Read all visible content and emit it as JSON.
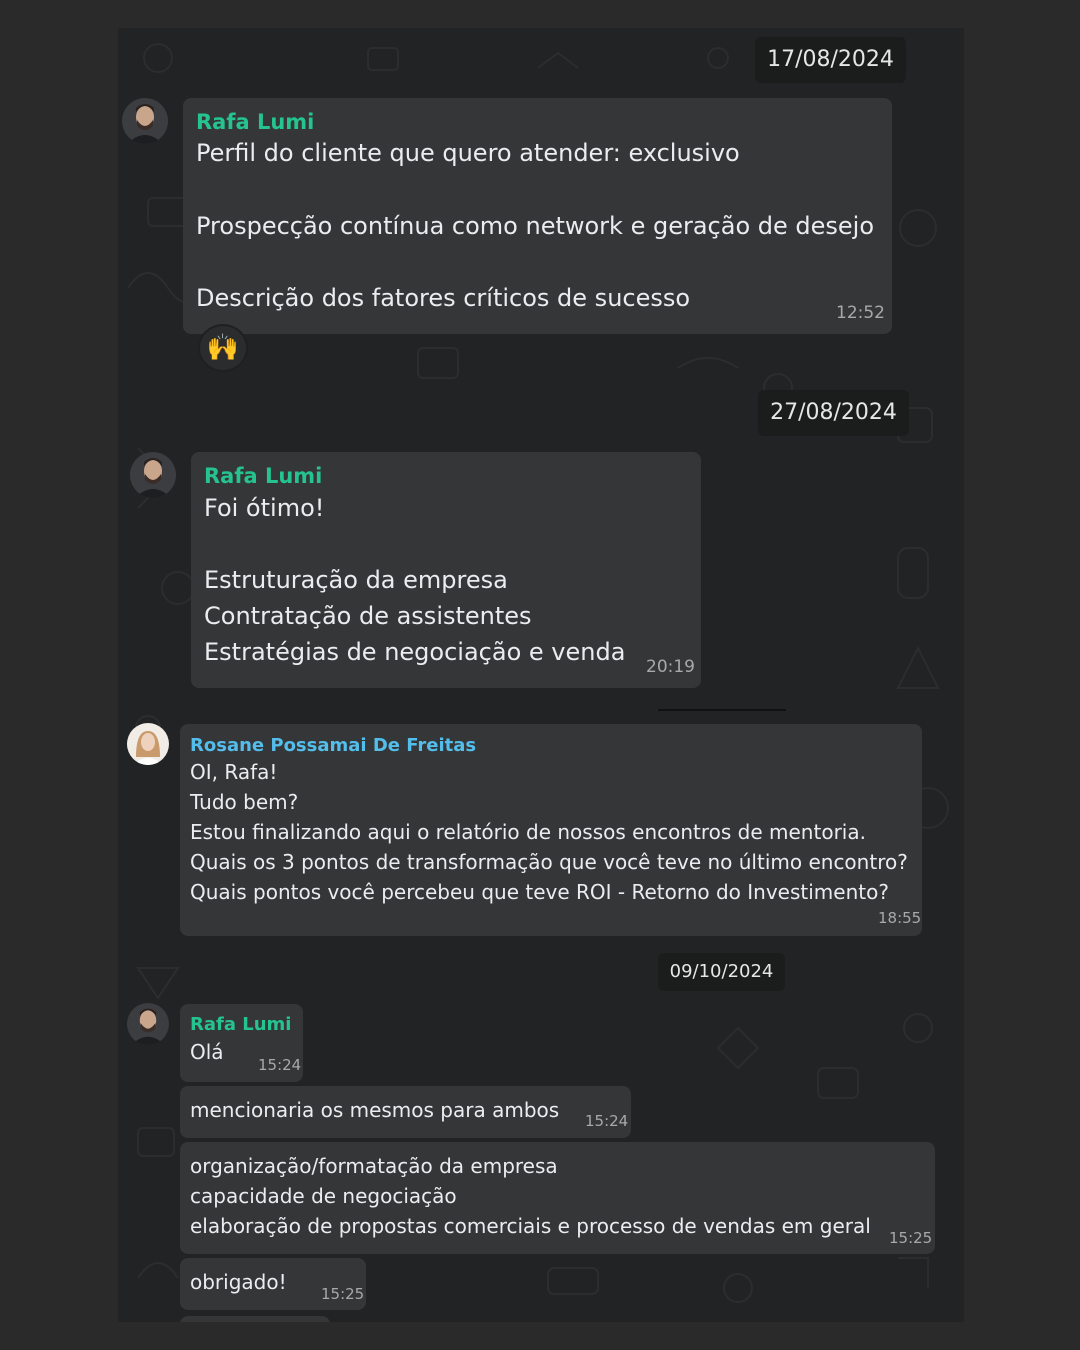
{
  "colors": {
    "page_bg": "#2a2a2a",
    "chat_bg": "#222324",
    "bubble_bg": "#353637",
    "date_pill_bg": "#1b1c1c",
    "sender_green": "#25c48f",
    "sender_blue": "#53bdeb",
    "time_text": "#a7a9aa"
  },
  "messages": {
    "date1": "17/08/2024",
    "m1": {
      "sender": "Rafa Lumi",
      "lines": [
        "Perfil do cliente que quero atender: exclusivo",
        "Prospecção contínua como network e geração de desejo",
        "Descrição dos fatores críticos de sucesso"
      ],
      "time": "12:52",
      "reaction": "🙌"
    },
    "date2": "27/08/2024",
    "m2": {
      "sender": "Rafa Lumi",
      "lines": [
        "Foi ótimo!",
        "Estruturação da empresa",
        "Contratação de assistentes",
        "Estratégias de negociação e venda"
      ],
      "time": "20:19"
    },
    "m3": {
      "sender": "Rosane Possamai De Freitas",
      "lines": [
        "OI, Rafa!",
        "Tudo bem?",
        "Estou finalizando aqui o relatório de nossos encontros de mentoria.",
        "Quais os 3 pontos de transformação que você teve no último encontro?",
        "Quais pontos você percebeu que teve ROI - Retorno do Investimento?"
      ],
      "time": "18:55"
    },
    "date3": "09/10/2024",
    "m4": {
      "sender": "Rafa Lumi",
      "lines": [
        "Olá"
      ],
      "time": "15:24"
    },
    "m5": {
      "lines": [
        "mencionaria os mesmos para ambos"
      ],
      "time": "15:24"
    },
    "m6": {
      "lines": [
        "organização/formatação da empresa",
        "capacidade de negociação",
        "elaboração de propostas comerciais e processo de vendas em geral"
      ],
      "time": "15:25"
    },
    "m7": {
      "lines": [
        "obrigado!"
      ],
      "time": "15:25"
    }
  }
}
